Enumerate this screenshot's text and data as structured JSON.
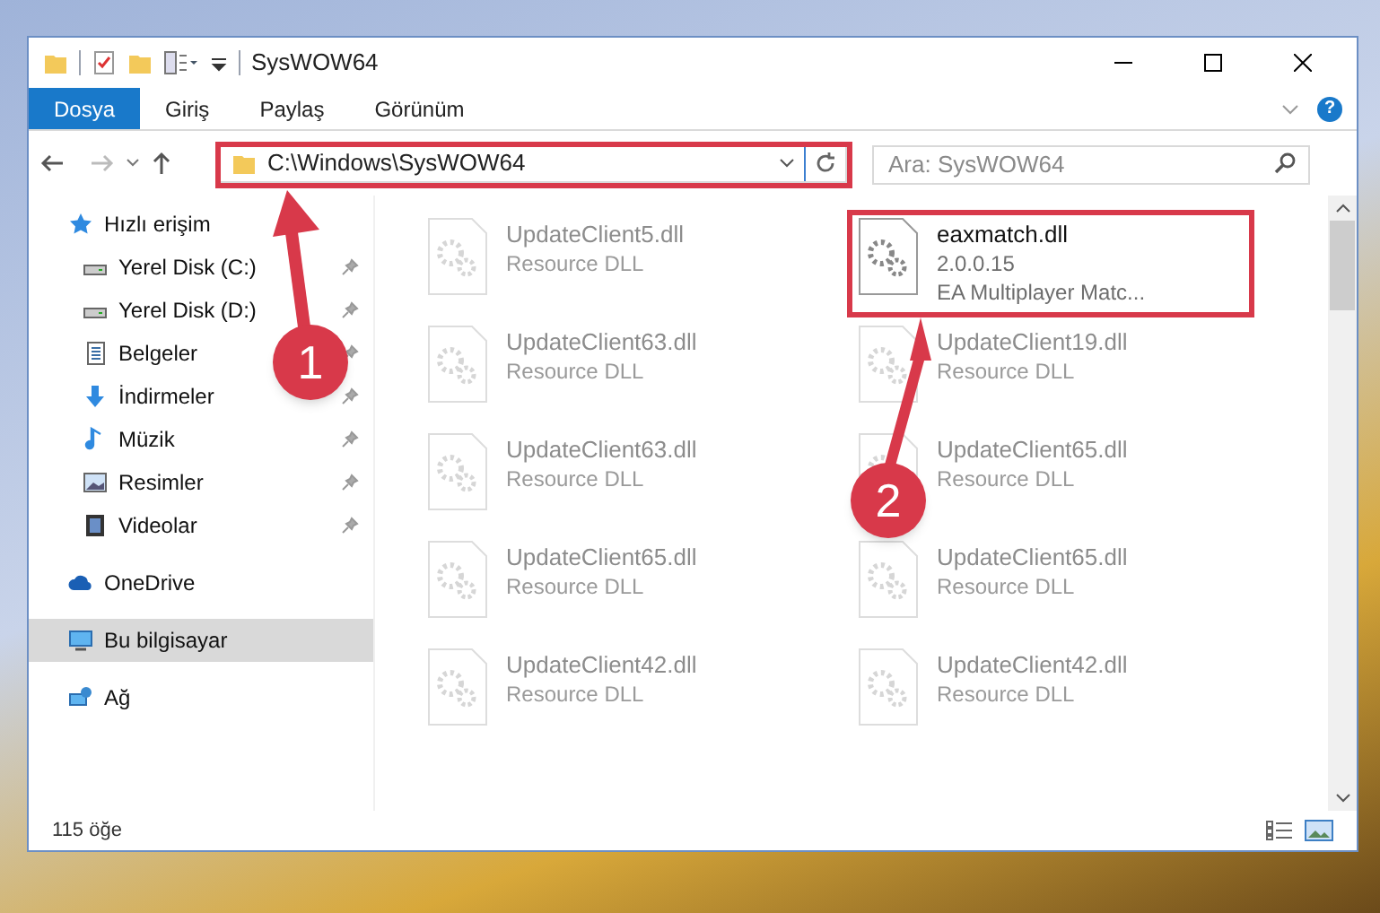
{
  "window": {
    "title": "SysWOW64"
  },
  "ribbon_tabs": [
    {
      "label": "Dosya",
      "selected": true
    },
    {
      "label": "Giriş",
      "selected": false
    },
    {
      "label": "Paylaş",
      "selected": false
    },
    {
      "label": "Görünüm",
      "selected": false
    }
  ],
  "address": {
    "path": "C:\\Windows\\SysWOW64"
  },
  "search": {
    "placeholder": "Ara: SysWOW64"
  },
  "sidebar": {
    "items": [
      {
        "label": "Hızlı erişim",
        "kind": "star",
        "selected": false,
        "children": [
          {
            "label": "Yerel Disk (C:)",
            "kind": "drive",
            "pinned": true,
            "selected": false
          },
          {
            "label": "Yerel Disk (D:)",
            "kind": "drive",
            "pinned": true,
            "selected": false
          },
          {
            "label": "Belgeler",
            "kind": "document",
            "pinned": true,
            "selected": false
          },
          {
            "label": "İndirmeler",
            "kind": "download",
            "pinned": true,
            "selected": false
          },
          {
            "label": "Müzik",
            "kind": "music",
            "pinned": true,
            "selected": false
          },
          {
            "label": "Resimler",
            "kind": "picture",
            "pinned": true,
            "selected": false
          },
          {
            "label": "Videolar",
            "kind": "video",
            "pinned": true,
            "selected": false
          }
        ]
      },
      {
        "label": "OneDrive",
        "kind": "cloud",
        "selected": false
      },
      {
        "label": "Bu bilgisayar",
        "kind": "computer",
        "selected": true
      },
      {
        "label": "Ağ",
        "kind": "network",
        "selected": false
      }
    ]
  },
  "files": [
    {
      "name": "UpdateClient5.dll",
      "line_2": "Resource DLL",
      "blurred": true
    },
    {
      "name": "eaxmatch.dll",
      "line_2": "2.0.0.15",
      "line_3": "EA Multiplayer Matc...",
      "blurred": false
    },
    {
      "name": "UpdateClient63.dll",
      "line_2": "Resource DLL",
      "blurred": true
    },
    {
      "name": "UpdateClient19.dll",
      "line_2": "Resource DLL",
      "blurred": true
    },
    {
      "name": "UpdateClient63.dll",
      "line_2": "Resource DLL",
      "blurred": true
    },
    {
      "name": "UpdateClient65.dll",
      "line_2": "Resource DLL",
      "blurred": true
    },
    {
      "name": "UpdateClient65.dll",
      "line_2": "Resource DLL",
      "blurred": true
    },
    {
      "name": "UpdateClient65.dll",
      "line_2": "Resource DLL",
      "blurred": true
    },
    {
      "name": "UpdateClient42.dll",
      "line_2": "Resource DLL",
      "blurred": true
    },
    {
      "name": "UpdateClient42.dll",
      "line_2": "Resource DLL",
      "blurred": true
    }
  ],
  "help_button": {
    "label": "?"
  },
  "status_bar": {
    "count": "115 öğe"
  },
  "annotations": [
    {
      "number": "1"
    },
    {
      "number": "2"
    }
  ]
}
